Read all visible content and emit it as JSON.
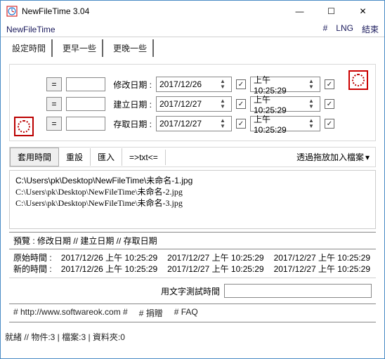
{
  "window": {
    "title": "NewFileTime 3.04"
  },
  "menu": {
    "app": "NewFileTime",
    "hash": "#",
    "lng": "LNG",
    "end": "結束"
  },
  "tabs": {
    "set": "設定時間",
    "earlier": "更早一些",
    "later": "更晚一些"
  },
  "rows": {
    "r1": {
      "eq": "=",
      "label": "修改日期 :",
      "date": "2017/12/26",
      "time": "上午 10:25:29"
    },
    "r2": {
      "eq": "=",
      "label": "建立日期 :",
      "date": "2017/12/27",
      "time": "上午 10:25:29"
    },
    "r3": {
      "eq": "=",
      "label": "存取日期 :",
      "date": "2017/12/27",
      "time": "上午 10:25:29"
    }
  },
  "toolbar": {
    "apply": "套用時間",
    "reset": "重設",
    "import": "匯入",
    "txt": "=>txt<=",
    "drag": "透過拖放加入檔案",
    "chevron": "▾"
  },
  "files": [
    "C:\\Users\\pk\\Desktop\\NewFileTime\\未命名-1.jpg",
    "C:\\Users\\pk\\Desktop\\NewFileTime\\未命名-2.jpg",
    "C:\\Users\\pk\\Desktop\\NewFileTime\\未命名-3.jpg"
  ],
  "preview": {
    "head": "預覽 :    修改日期   //   建立日期   //   存取日期",
    "orig": "原始時間 :",
    "new": "新的時間 :",
    "c1a": "2017/12/26 上午 10:25:29",
    "c1b": "2017/12/26 上午 10:25:29",
    "c2a": "2017/12/27 上午 10:25:29",
    "c2b": "2017/12/27 上午 10:25:29",
    "c3a": "2017/12/27 上午 10:25:29",
    "c3b": "2017/12/27 上午 10:25:29"
  },
  "test": {
    "label": "用文字測試時間",
    "value": ""
  },
  "links": {
    "site": "# http://www.softwareok.com #",
    "donate": "# 捐贈",
    "faq": "# FAQ"
  },
  "status": "就緒 // 物件:3 | 檔案:3  | 資料夾:0",
  "glyph": {
    "check": "✓",
    "up": "▲",
    "down": "▼",
    "min": "—",
    "max": "☐",
    "close": "✕"
  }
}
